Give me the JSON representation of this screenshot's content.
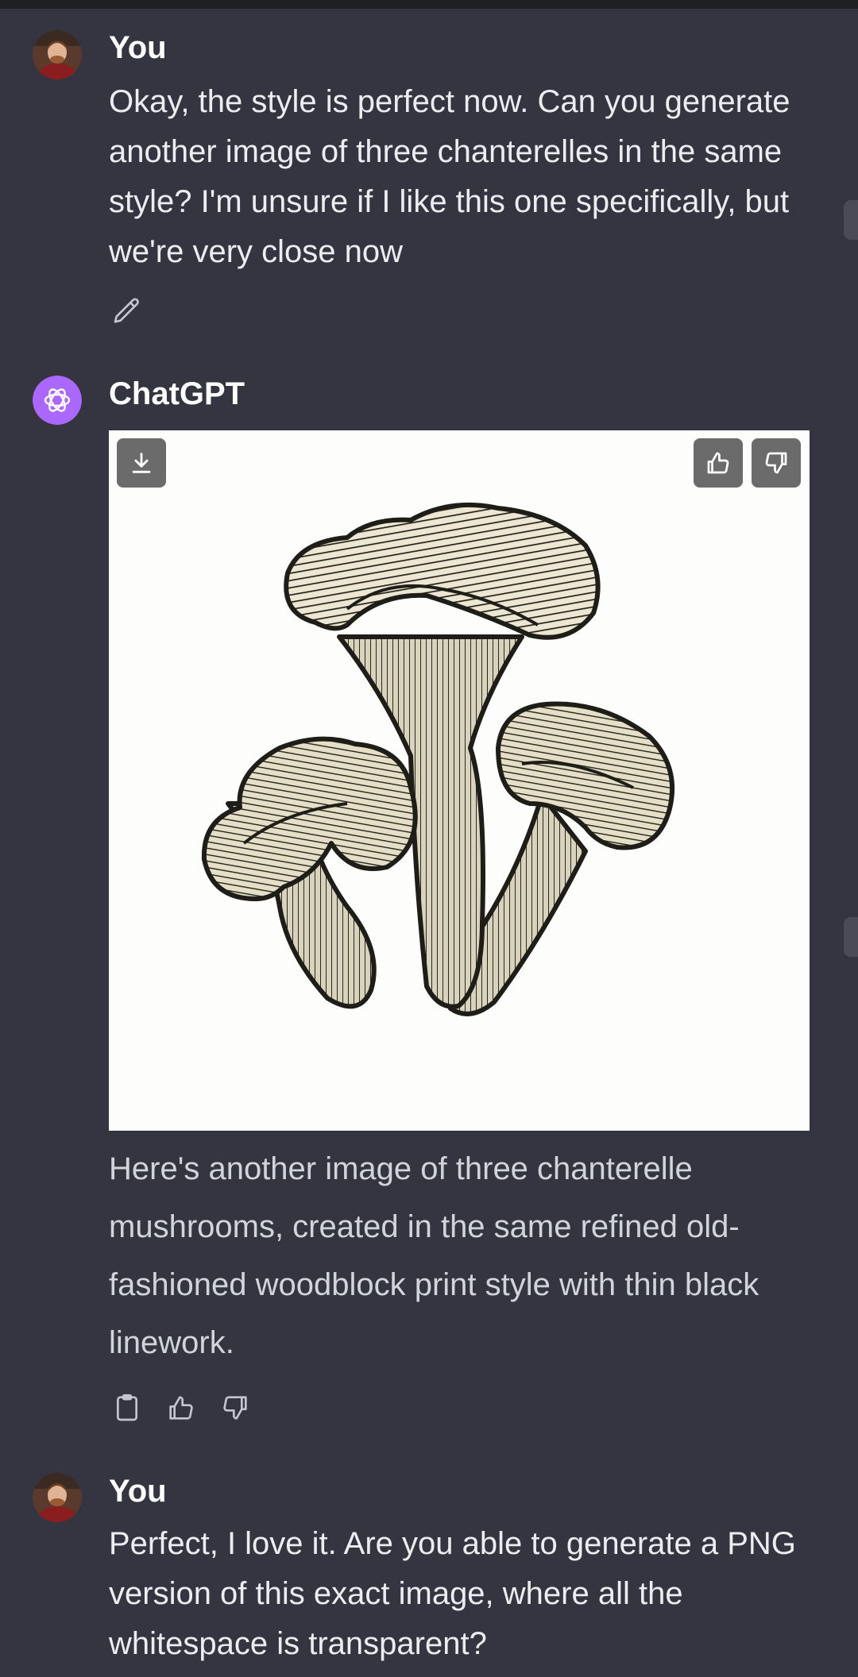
{
  "conversation": {
    "messages": [
      {
        "author": "You",
        "text": "Okay, the style is perfect now.  Can you generate another image of three chanterelles in the same style?  I'm unsure if I like this one specifically, but we're very close now"
      },
      {
        "author": "ChatGPT",
        "text": "Here's another image of three chanterelle mushrooms, created in the same refined old-fashioned woodblock print style with thin black linework."
      },
      {
        "author": "You",
        "text": "Perfect, I love it.  Are you able to generate a PNG version of this exact image, where all the whitespace is transparent?"
      }
    ]
  },
  "icons": {
    "edit": "pencil-icon",
    "download": "download-icon",
    "like": "thumbs-up-icon",
    "dislike": "thumbs-down-icon",
    "copy": "clipboard-icon"
  },
  "colors": {
    "background": "#343541",
    "assistant_avatar": "#ab68ff",
    "overlay_button": "#6b6b6b"
  }
}
